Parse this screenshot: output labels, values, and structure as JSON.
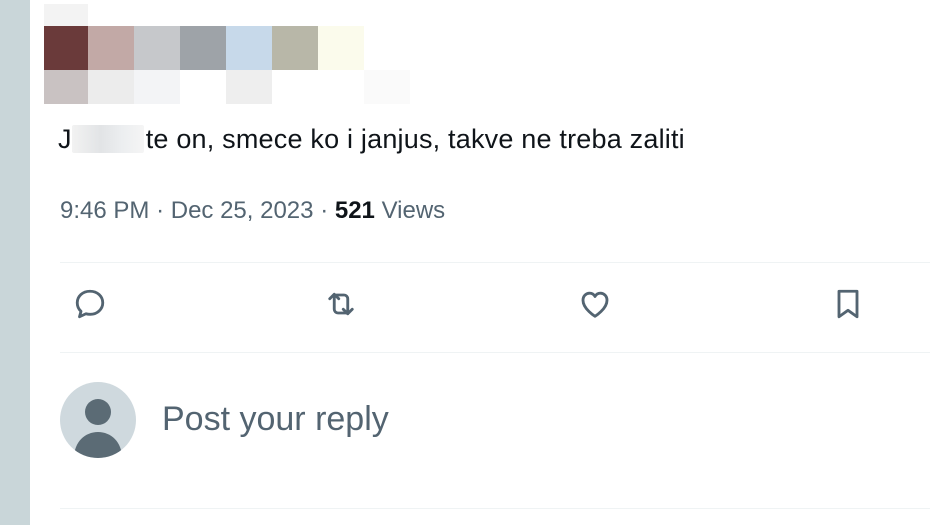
{
  "tweet": {
    "text_visible": "te on, smece ko i janjus, takve ne treba zaliti",
    "time": "9:46 PM",
    "separator": "·",
    "date": "Dec 25, 2023",
    "views_count": "521",
    "views_label": "Views"
  },
  "actions": [
    "reply-icon",
    "repost-icon",
    "like-icon",
    "bookmark-icon"
  ],
  "reply": {
    "placeholder": "Post your reply"
  },
  "colors": {
    "text": "#0f1419",
    "secondary": "#536471",
    "avatar_bg": "#cfd9de",
    "avatar_fg": "#5b6b75",
    "divider": "#eff3f4"
  }
}
